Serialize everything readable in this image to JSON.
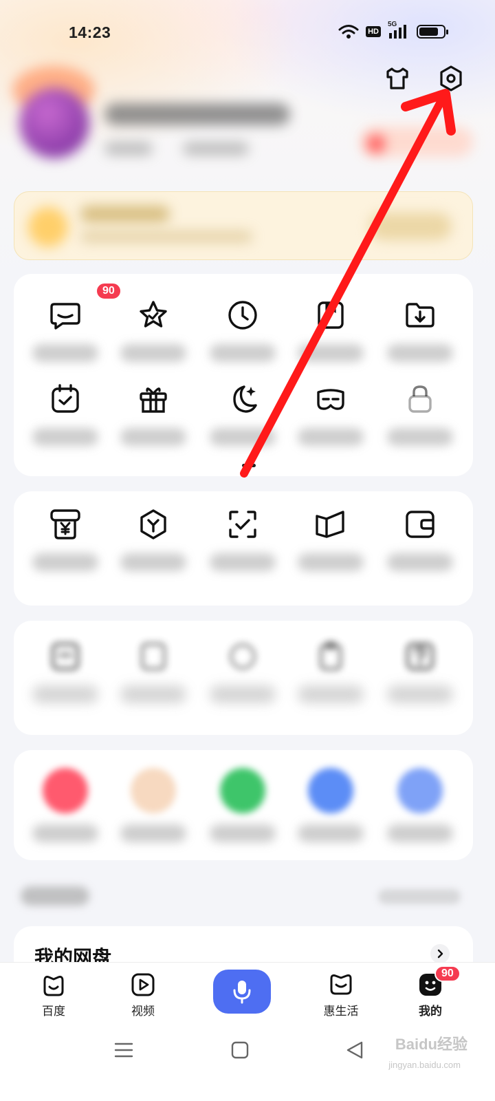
{
  "status_bar": {
    "time": "14:23",
    "network_badge": "HD",
    "cellular": "5G",
    "battery_level": 0.8
  },
  "top_actions": [
    {
      "name": "skin-icon"
    },
    {
      "name": "settings-icon"
    }
  ],
  "grid_1": {
    "items": [
      {
        "icon": "message-icon",
        "badge": "90"
      },
      {
        "icon": "star-icon"
      },
      {
        "icon": "clock-icon"
      },
      {
        "icon": "bookmark-icon"
      },
      {
        "icon": "download-folder-icon"
      },
      {
        "icon": "calendar-check-icon"
      },
      {
        "icon": "gift-icon"
      },
      {
        "icon": "moon-icon"
      },
      {
        "icon": "mask-icon"
      },
      {
        "icon": "lock-icon"
      }
    ]
  },
  "grid_2": {
    "items": [
      {
        "icon": "yuan-ticket-icon"
      },
      {
        "icon": "hexagon-icon"
      },
      {
        "icon": "scan-check-icon"
      },
      {
        "icon": "book-open-icon"
      },
      {
        "icon": "wallet-icon"
      }
    ]
  },
  "grid_3": {
    "items": [
      {
        "icon": "note-icon"
      },
      {
        "icon": "document-icon"
      },
      {
        "icon": "tool-icon"
      },
      {
        "icon": "clipboard-icon"
      },
      {
        "icon": "help-icon"
      }
    ]
  },
  "grid_4": {
    "items": [
      {
        "color": "#ff5a6e"
      },
      {
        "color": "#f7d9c0"
      },
      {
        "color": "#3ec56a"
      },
      {
        "color": "#5c8df6"
      },
      {
        "color": "#7fa2f7"
      }
    ]
  },
  "netdisk": {
    "title": "我的网盘"
  },
  "bottom_nav": {
    "items": [
      {
        "label": "百度",
        "icon": "baidu-home-icon"
      },
      {
        "label": "视频",
        "icon": "video-play-icon"
      },
      {
        "label": "",
        "icon": "microphone-icon"
      },
      {
        "label": "惠生活",
        "icon": "life-icon"
      },
      {
        "label": "我的",
        "icon": "profile-face-icon",
        "badge": "90",
        "active": true
      }
    ]
  },
  "watermark": {
    "brand": "Baidu经验",
    "url": "jingyan.baidu.com"
  },
  "colors": {
    "accent": "#4e6ef2",
    "badge": "#f53b50",
    "annotation_arrow": "#ff1a1a"
  }
}
